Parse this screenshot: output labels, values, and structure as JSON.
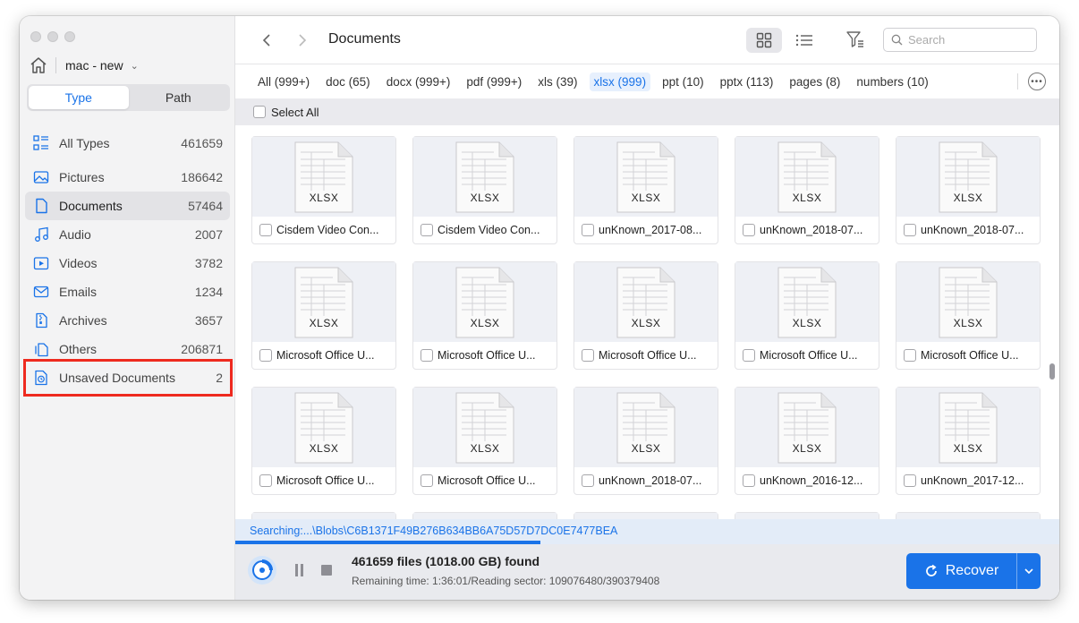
{
  "sidebar": {
    "device_name": "mac - new",
    "segments": [
      "Type",
      "Path"
    ],
    "active_segment": "Type",
    "items": [
      {
        "label": "All Types",
        "count": "461659",
        "icon": "all-types-icon"
      },
      {
        "label": "Pictures",
        "count": "186642",
        "icon": "pictures-icon"
      },
      {
        "label": "Documents",
        "count": "57464",
        "icon": "documents-icon",
        "selected": true
      },
      {
        "label": "Audio",
        "count": "2007",
        "icon": "audio-icon"
      },
      {
        "label": "Videos",
        "count": "3782",
        "icon": "videos-icon"
      },
      {
        "label": "Emails",
        "count": "1234",
        "icon": "emails-icon"
      },
      {
        "label": "Archives",
        "count": "3657",
        "icon": "archives-icon"
      },
      {
        "label": "Others",
        "count": "206871",
        "icon": "others-icon"
      },
      {
        "label": "Unsaved Documents",
        "count": "2",
        "icon": "unsaved-documents-icon",
        "highlighted": true
      }
    ]
  },
  "header": {
    "title": "Documents",
    "search_placeholder": "Search"
  },
  "tabs": [
    {
      "label": "All (999+)"
    },
    {
      "label": "doc (65)"
    },
    {
      "label": "docx (999+)"
    },
    {
      "label": "pdf (999+)"
    },
    {
      "label": "xls (39)"
    },
    {
      "label": "xlsx (999)",
      "active": true
    },
    {
      "label": "ppt (10)"
    },
    {
      "label": "pptx (113)"
    },
    {
      "label": "pages (8)"
    },
    {
      "label": "numbers (10)"
    }
  ],
  "select_all_label": "Select All",
  "files": [
    {
      "name": "Cisdem Video Con...",
      "type": "XLSX"
    },
    {
      "name": "Cisdem Video Con...",
      "type": "XLSX"
    },
    {
      "name": "unKnown_2017-08...",
      "type": "XLSX"
    },
    {
      "name": "unKnown_2018-07...",
      "type": "XLSX"
    },
    {
      "name": "unKnown_2018-07...",
      "type": "XLSX"
    },
    {
      "name": "Microsoft Office U...",
      "type": "XLSX"
    },
    {
      "name": "Microsoft Office U...",
      "type": "XLSX"
    },
    {
      "name": "Microsoft Office U...",
      "type": "XLSX"
    },
    {
      "name": "Microsoft Office U...",
      "type": "XLSX"
    },
    {
      "name": "Microsoft Office U...",
      "type": "XLSX"
    },
    {
      "name": "Microsoft Office U...",
      "type": "XLSX"
    },
    {
      "name": "Microsoft Office U...",
      "type": "XLSX"
    },
    {
      "name": "unKnown_2018-07...",
      "type": "XLSX"
    },
    {
      "name": "unKnown_2016-12...",
      "type": "XLSX"
    },
    {
      "name": "unKnown_2017-12...",
      "type": "XLSX"
    }
  ],
  "status": {
    "searching_text": "Searching:...\\Blobs\\C6B1371F49B276B634BB6A75D57D7DC0E7477BEA",
    "progress": 0.37,
    "found_text": "461659 files (1018.00 GB) found",
    "remaining_text": "Remaining time: 1:36:01/Reading sector: 109076480/390379408"
  },
  "recover_label": "Recover",
  "colors": {
    "accent": "#1a73e8",
    "highlight_border": "#ee2a1f"
  }
}
